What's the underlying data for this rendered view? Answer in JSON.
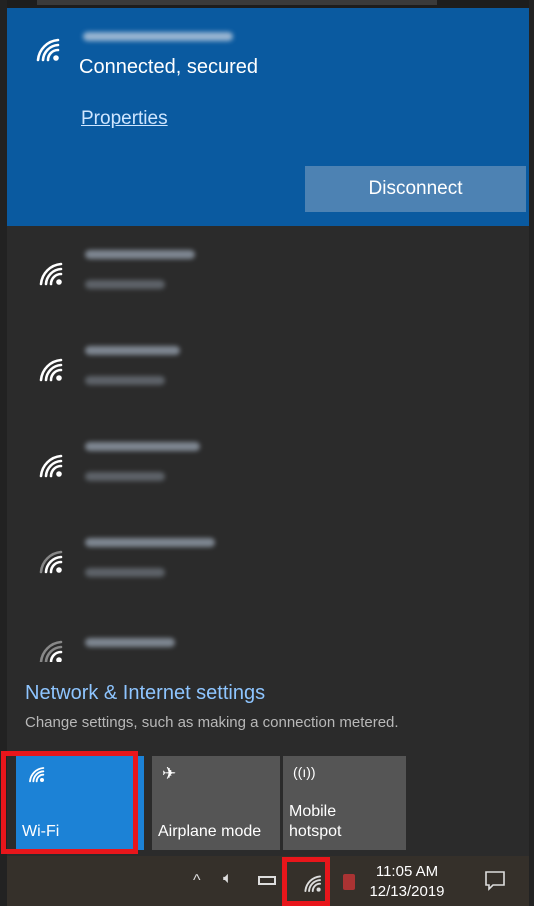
{
  "connected_network": {
    "status": "Connected, secured",
    "properties_label": "Properties",
    "disconnect_label": "Disconnect"
  },
  "settings": {
    "title": "Network & Internet settings",
    "subtitle": "Change settings, such as making a connection metered."
  },
  "quick_actions": [
    {
      "label": "Wi-Fi",
      "icon": "wifi-icon",
      "active": true
    },
    {
      "label": "Airplane mode",
      "icon": "airplane-icon",
      "active": false
    },
    {
      "label_line1": "Mobile",
      "label_line2": "hotspot",
      "icon": "hotspot-icon",
      "active": false
    }
  ],
  "taskbar": {
    "time": "11:05 AM",
    "date": "12/13/2019"
  },
  "colors": {
    "accent": "#1c82d6",
    "connected_bg": "#0a5aa0",
    "highlight": "#e8161b"
  }
}
